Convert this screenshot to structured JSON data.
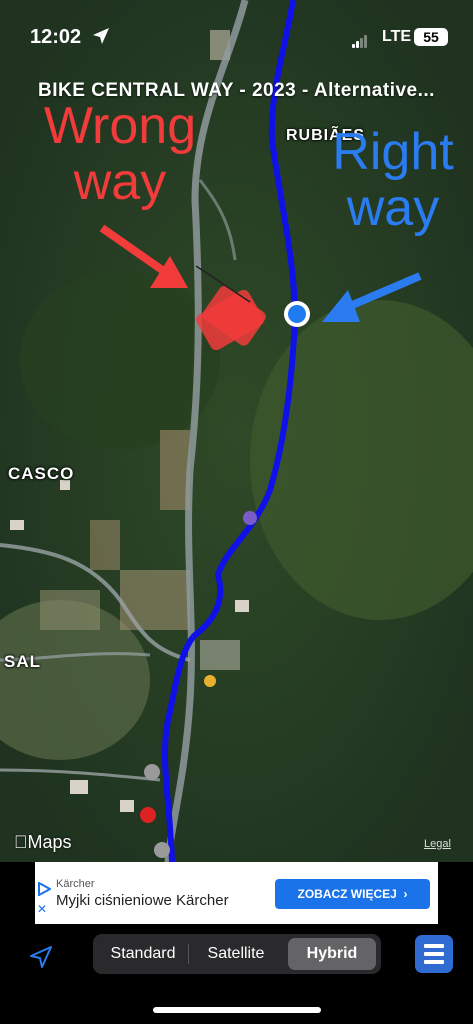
{
  "status_bar": {
    "time": "12:02",
    "network": "LTE",
    "battery": "55"
  },
  "map": {
    "title": "BIKE CENTRAL WAY - 2023 - Alternative...",
    "places": [
      "RUBIÃES",
      "CASCO",
      "SAL"
    ],
    "annotations": {
      "wrong": "Wrong way",
      "right": "Right way"
    },
    "logo_text": "Maps",
    "legal_label": "Legal",
    "colors": {
      "route": "#1010e8",
      "wrong": "#f23b3b",
      "right": "#2a7cf0"
    }
  },
  "ad": {
    "brand": "Kärcher",
    "headline": "Myjki ciśnieniowe Kärcher",
    "cta": "ZOBACZ WIĘCEJ"
  },
  "toolbar": {
    "map_types": [
      "Standard",
      "Satellite",
      "Hybrid"
    ],
    "selected": "Hybrid"
  }
}
